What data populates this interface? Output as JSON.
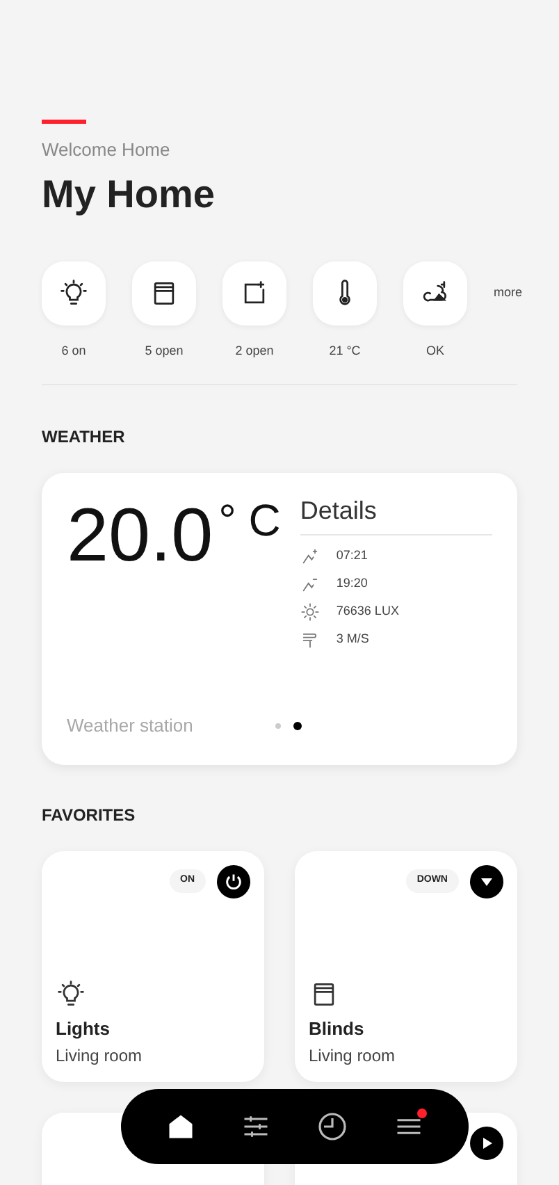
{
  "header": {
    "subtitle": "Welcome Home",
    "title": "My Home"
  },
  "quick_status": [
    {
      "kind": "light",
      "label": "6 on"
    },
    {
      "kind": "blind",
      "label": "5 open"
    },
    {
      "kind": "window",
      "label": "2 open"
    },
    {
      "kind": "thermo",
      "label": "21 °C"
    },
    {
      "kind": "weather",
      "label": "OK"
    }
  ],
  "more": "more",
  "weather": {
    "heading": "WEATHER",
    "temperature": "20.0",
    "unit": "° C",
    "details_title": "Details",
    "details": [
      {
        "kind": "sunrise",
        "value": "07:21"
      },
      {
        "kind": "sunset",
        "value": "19:20"
      },
      {
        "kind": "sun",
        "value": "76636 LUX"
      },
      {
        "kind": "wind",
        "value": "3 M/S"
      }
    ],
    "source": "Weather station",
    "pages": [
      {
        "selected": false
      },
      {
        "selected": true
      }
    ]
  },
  "favorites": {
    "heading": "FAVORITES",
    "items": [
      {
        "kind": "light",
        "title": "Lights",
        "room": "Living room",
        "state": "ON",
        "button": {
          "kind": "power"
        }
      },
      {
        "kind": "blind",
        "title": "Blinds",
        "room": "Living room",
        "state": "DOWN",
        "button": {
          "kind": "down"
        }
      },
      {
        "kind": "empty"
      },
      {
        "kind": "empty",
        "button": {
          "kind": "play"
        }
      }
    ]
  },
  "nav": [
    {
      "kind": "home",
      "selected": true
    },
    {
      "kind": "controls",
      "selected": false
    },
    {
      "kind": "clock",
      "selected": false
    },
    {
      "kind": "menu",
      "selected": false,
      "badge": true
    }
  ]
}
